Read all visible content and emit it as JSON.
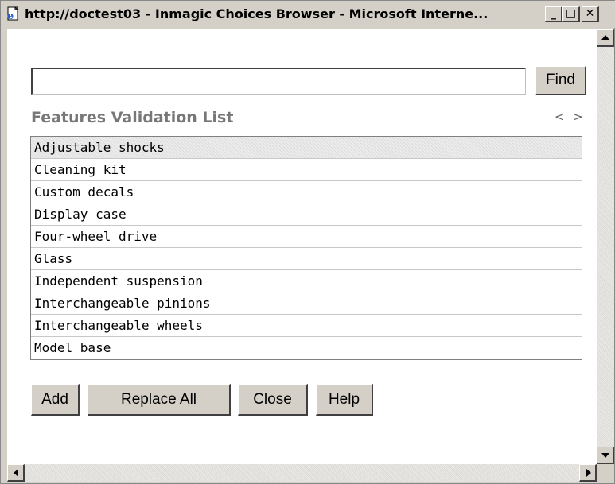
{
  "window": {
    "title": "http://doctest03 - Inmagic Choices Browser - Microsoft Interne...",
    "minimize_glyph": "_",
    "maximize_glyph": "□",
    "close_glyph": "✕"
  },
  "search": {
    "value": "",
    "placeholder": "",
    "find_label": "Find"
  },
  "list": {
    "title": "Features Validation List",
    "prev_label": "<",
    "next_label": ">",
    "selected_index": 0,
    "items": [
      "Adjustable shocks",
      "Cleaning kit",
      "Custom decals",
      "Display case",
      "Four-wheel drive",
      "Glass",
      "Independent suspension",
      "Interchangeable pinions",
      "Interchangeable wheels",
      "Model base"
    ]
  },
  "buttons": {
    "add": "Add",
    "replace_all": "Replace All",
    "close": "Close",
    "help": "Help"
  },
  "icons": {
    "window": "ie-page-icon",
    "scroll_up": "arrow-up-icon",
    "scroll_down": "arrow-down-icon",
    "scroll_left": "arrow-left-icon",
    "scroll_right": "arrow-right-icon"
  },
  "colors": {
    "chrome": "#d4d0c8",
    "list_title": "#777777"
  }
}
